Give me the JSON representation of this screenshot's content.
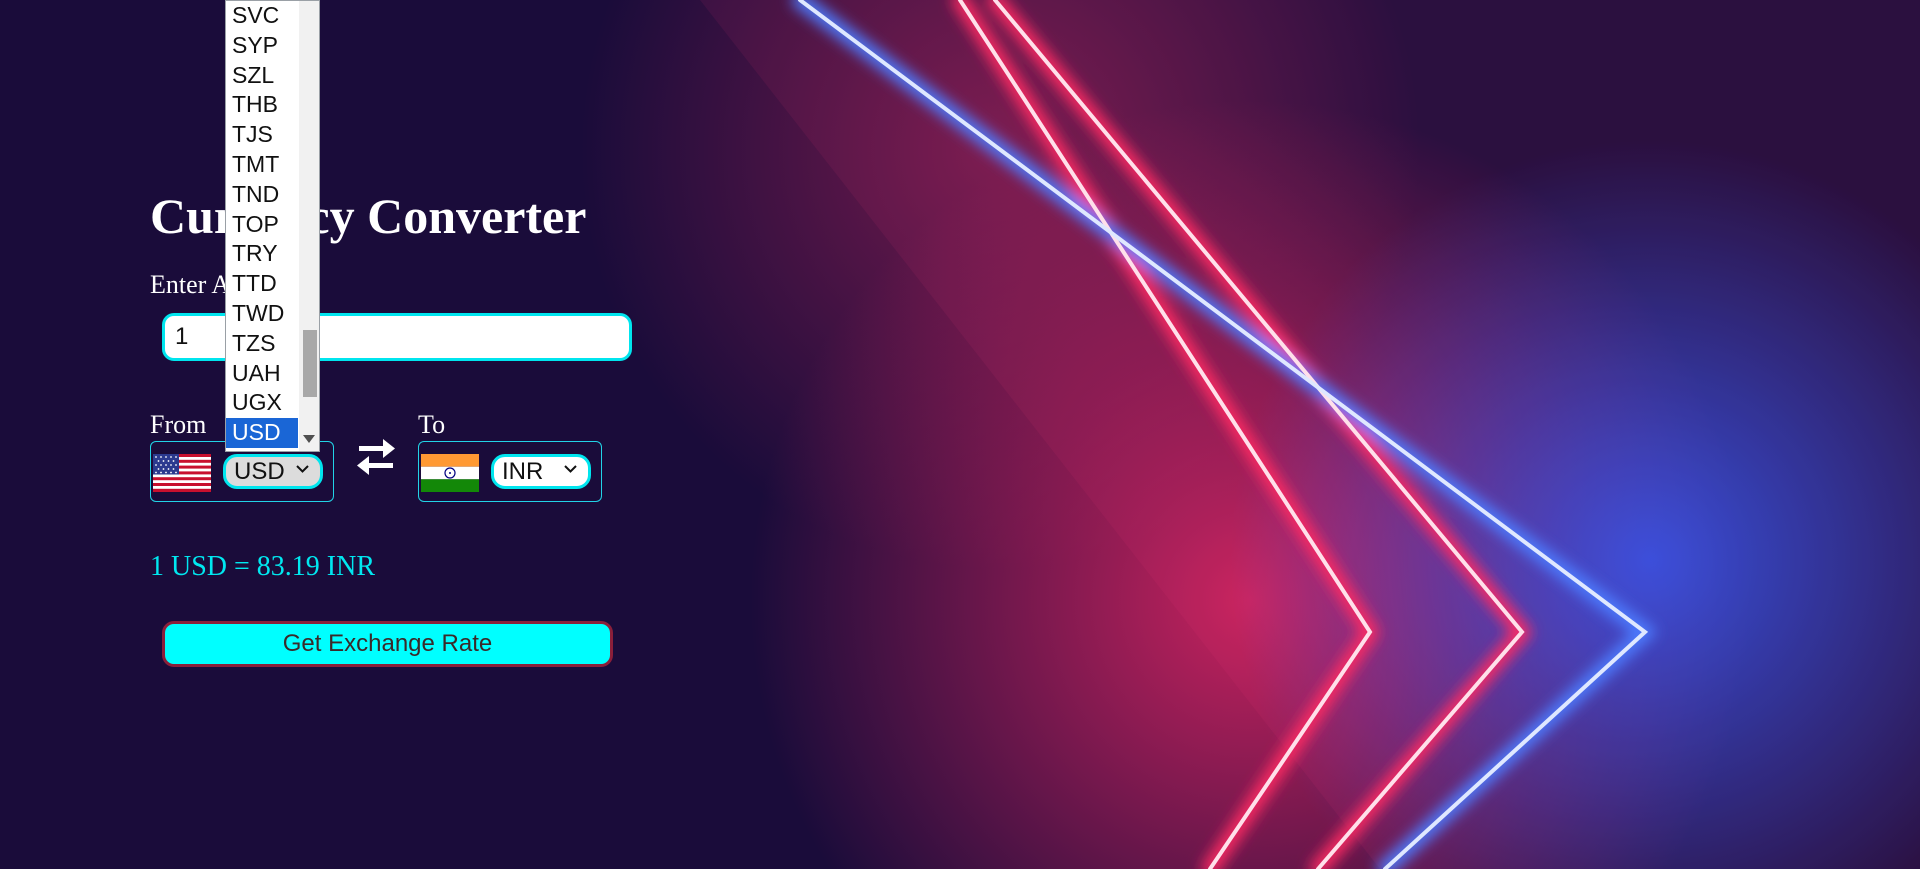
{
  "app": {
    "title": "Currency Converter"
  },
  "amount": {
    "label": "Enter Amount",
    "value": "1"
  },
  "from": {
    "label": "From",
    "selected": "USD",
    "flag_icon": "us-flag-icon"
  },
  "to": {
    "label": "To",
    "selected": "INR",
    "flag_icon": "india-flag-icon"
  },
  "swap_icon": "swap-arrows-icon",
  "result": {
    "text": "1 USD = 83.19 INR"
  },
  "button": {
    "label": "Get Exchange Rate"
  },
  "dropdown": {
    "options": [
      "SVC",
      "SYP",
      "SZL",
      "THB",
      "TJS",
      "TMT",
      "TND",
      "TOP",
      "TRY",
      "TTD",
      "TWD",
      "TZS",
      "UAH",
      "UGX",
      "USD"
    ],
    "selected": "USD"
  },
  "colors": {
    "background": "#1a0c3a",
    "accent": "#00ffff",
    "result_text": "#00e8f0",
    "dropdown_highlight": "#1a66d6"
  }
}
